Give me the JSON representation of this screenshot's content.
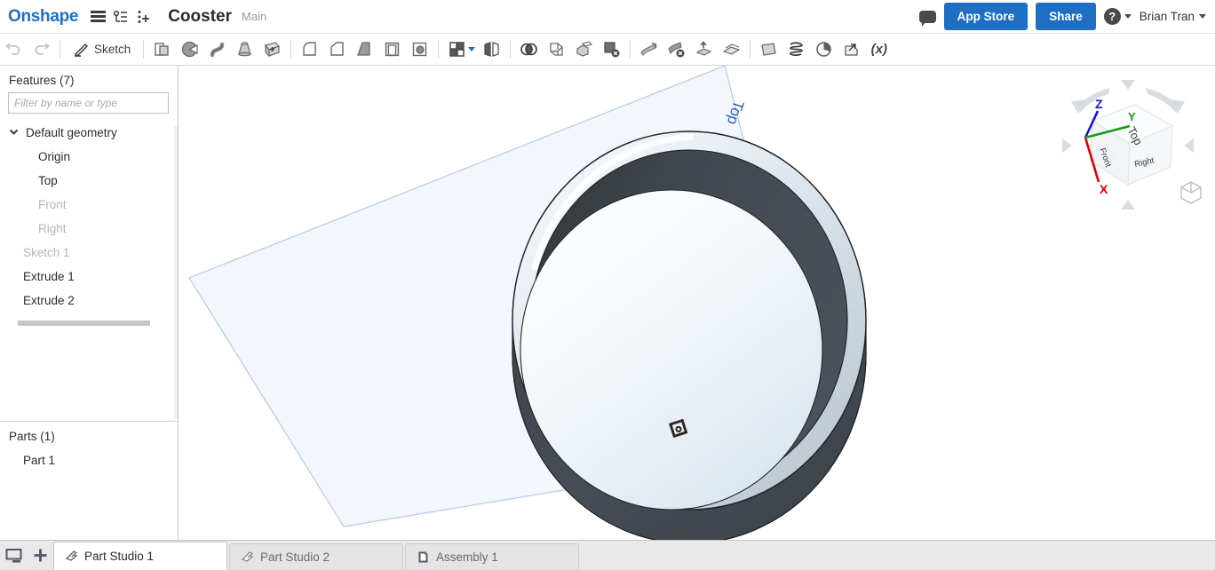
{
  "header": {
    "logo": "Onshape",
    "menu_icon": "hamburger-icon",
    "versions_icon": "version-graph-icon",
    "insert_icon": "add-feature-icon",
    "document_title": "Cooster",
    "branch": "Main",
    "comment_icon": "comment-icon",
    "app_store_label": "App Store",
    "share_label": "Share",
    "help_label": "?",
    "user_name": "Brian Tran"
  },
  "toolbar": {
    "undo_icon": "undo-arrow-icon",
    "redo_icon": "redo-arrow-icon",
    "sketch_label": "Sketch",
    "sketch_icon": "pencil-icon",
    "tools": [
      {
        "name": "extrude-tool",
        "icon": "extrude-icon"
      },
      {
        "name": "revolve-tool",
        "icon": "revolve-icon"
      },
      {
        "name": "sweep-tool",
        "icon": "sweep-icon"
      },
      {
        "name": "loft-tool",
        "icon": "loft-icon"
      },
      {
        "name": "thicken-tool",
        "icon": "thicken-icon"
      },
      {
        "name": "fillet-tool",
        "icon": "fillet-icon"
      },
      {
        "name": "chamfer-tool",
        "icon": "chamfer-icon"
      },
      {
        "name": "draft-tool",
        "icon": "draft-icon"
      },
      {
        "name": "shell-tool",
        "icon": "shell-icon"
      },
      {
        "name": "hole-tool",
        "icon": "hole-icon"
      },
      {
        "name": "pattern-tool",
        "icon": "pattern-icon"
      },
      {
        "name": "mirror-tool",
        "icon": "mirror-icon"
      },
      {
        "name": "boolean-tool",
        "icon": "boolean-icon"
      },
      {
        "name": "split-tool",
        "icon": "split-icon"
      },
      {
        "name": "transform-tool",
        "icon": "transform-icon"
      },
      {
        "name": "delete-part-tool",
        "icon": "delete-part-icon"
      },
      {
        "name": "move-face-tool",
        "icon": "move-face-icon"
      },
      {
        "name": "delete-face-tool",
        "icon": "delete-face-icon"
      },
      {
        "name": "replace-face-tool",
        "icon": "replace-face-icon"
      },
      {
        "name": "offset-surface-tool",
        "icon": "offset-surface-icon"
      },
      {
        "name": "plane-tool",
        "icon": "plane-icon"
      },
      {
        "name": "helix-tool",
        "icon": "helix-icon"
      },
      {
        "name": "curve-tool",
        "icon": "curve-icon"
      },
      {
        "name": "derive-tool",
        "icon": "derive-icon"
      },
      {
        "name": "variable-tool",
        "icon": "variable-icon"
      }
    ],
    "variable_label": "(x)"
  },
  "features_panel": {
    "title": "Features (7)",
    "filter_placeholder": "Filter by name or type",
    "default_geometry_label": "Default geometry",
    "chevron": "⌄",
    "items": [
      {
        "label": "Origin",
        "dimmed": false,
        "indent": "child"
      },
      {
        "label": "Top",
        "dimmed": false,
        "indent": "child"
      },
      {
        "label": "Front",
        "dimmed": true,
        "indent": "child"
      },
      {
        "label": "Right",
        "dimmed": true,
        "indent": "child"
      },
      {
        "label": "Sketch 1",
        "dimmed": true,
        "indent": "child2"
      },
      {
        "label": "Extrude 1",
        "dimmed": false,
        "indent": "child2"
      },
      {
        "label": "Extrude 2",
        "dimmed": false,
        "indent": "child2"
      }
    ]
  },
  "parts_panel": {
    "title": "Parts (1)",
    "items": [
      {
        "label": "Part 1"
      }
    ]
  },
  "viewport": {
    "plane_label": "Top",
    "plane_label_color": "#2f62b5",
    "origin_icon": "origin-marker-icon",
    "background": "#ffffff",
    "model": {
      "name": "coaster-ring",
      "outer_rim_color": "#e9eef3",
      "inner_wall_color": "#3f464d",
      "floor_color": "#f2f6f9",
      "edge_color": "#1f1f1f"
    }
  },
  "viewcube": {
    "faces": [
      "Top",
      "Front",
      "Right"
    ],
    "axes": [
      {
        "label": "X",
        "color": "#e00000"
      },
      {
        "label": "Y",
        "color": "#12a012"
      },
      {
        "label": "Z",
        "color": "#1414e0"
      }
    ],
    "view_button_icon": "isometric-view-icon"
  },
  "tabbar": {
    "panel_icon": "panel-toggle-icon",
    "add_icon": "add-tab-icon",
    "add_label": "+",
    "tabs": [
      {
        "label": "Part Studio 1",
        "icon": "part-studio-icon",
        "active": true
      },
      {
        "label": "Part Studio 2",
        "icon": "part-studio-icon",
        "active": false
      },
      {
        "label": "Assembly 1",
        "icon": "assembly-icon",
        "active": false
      }
    ]
  }
}
